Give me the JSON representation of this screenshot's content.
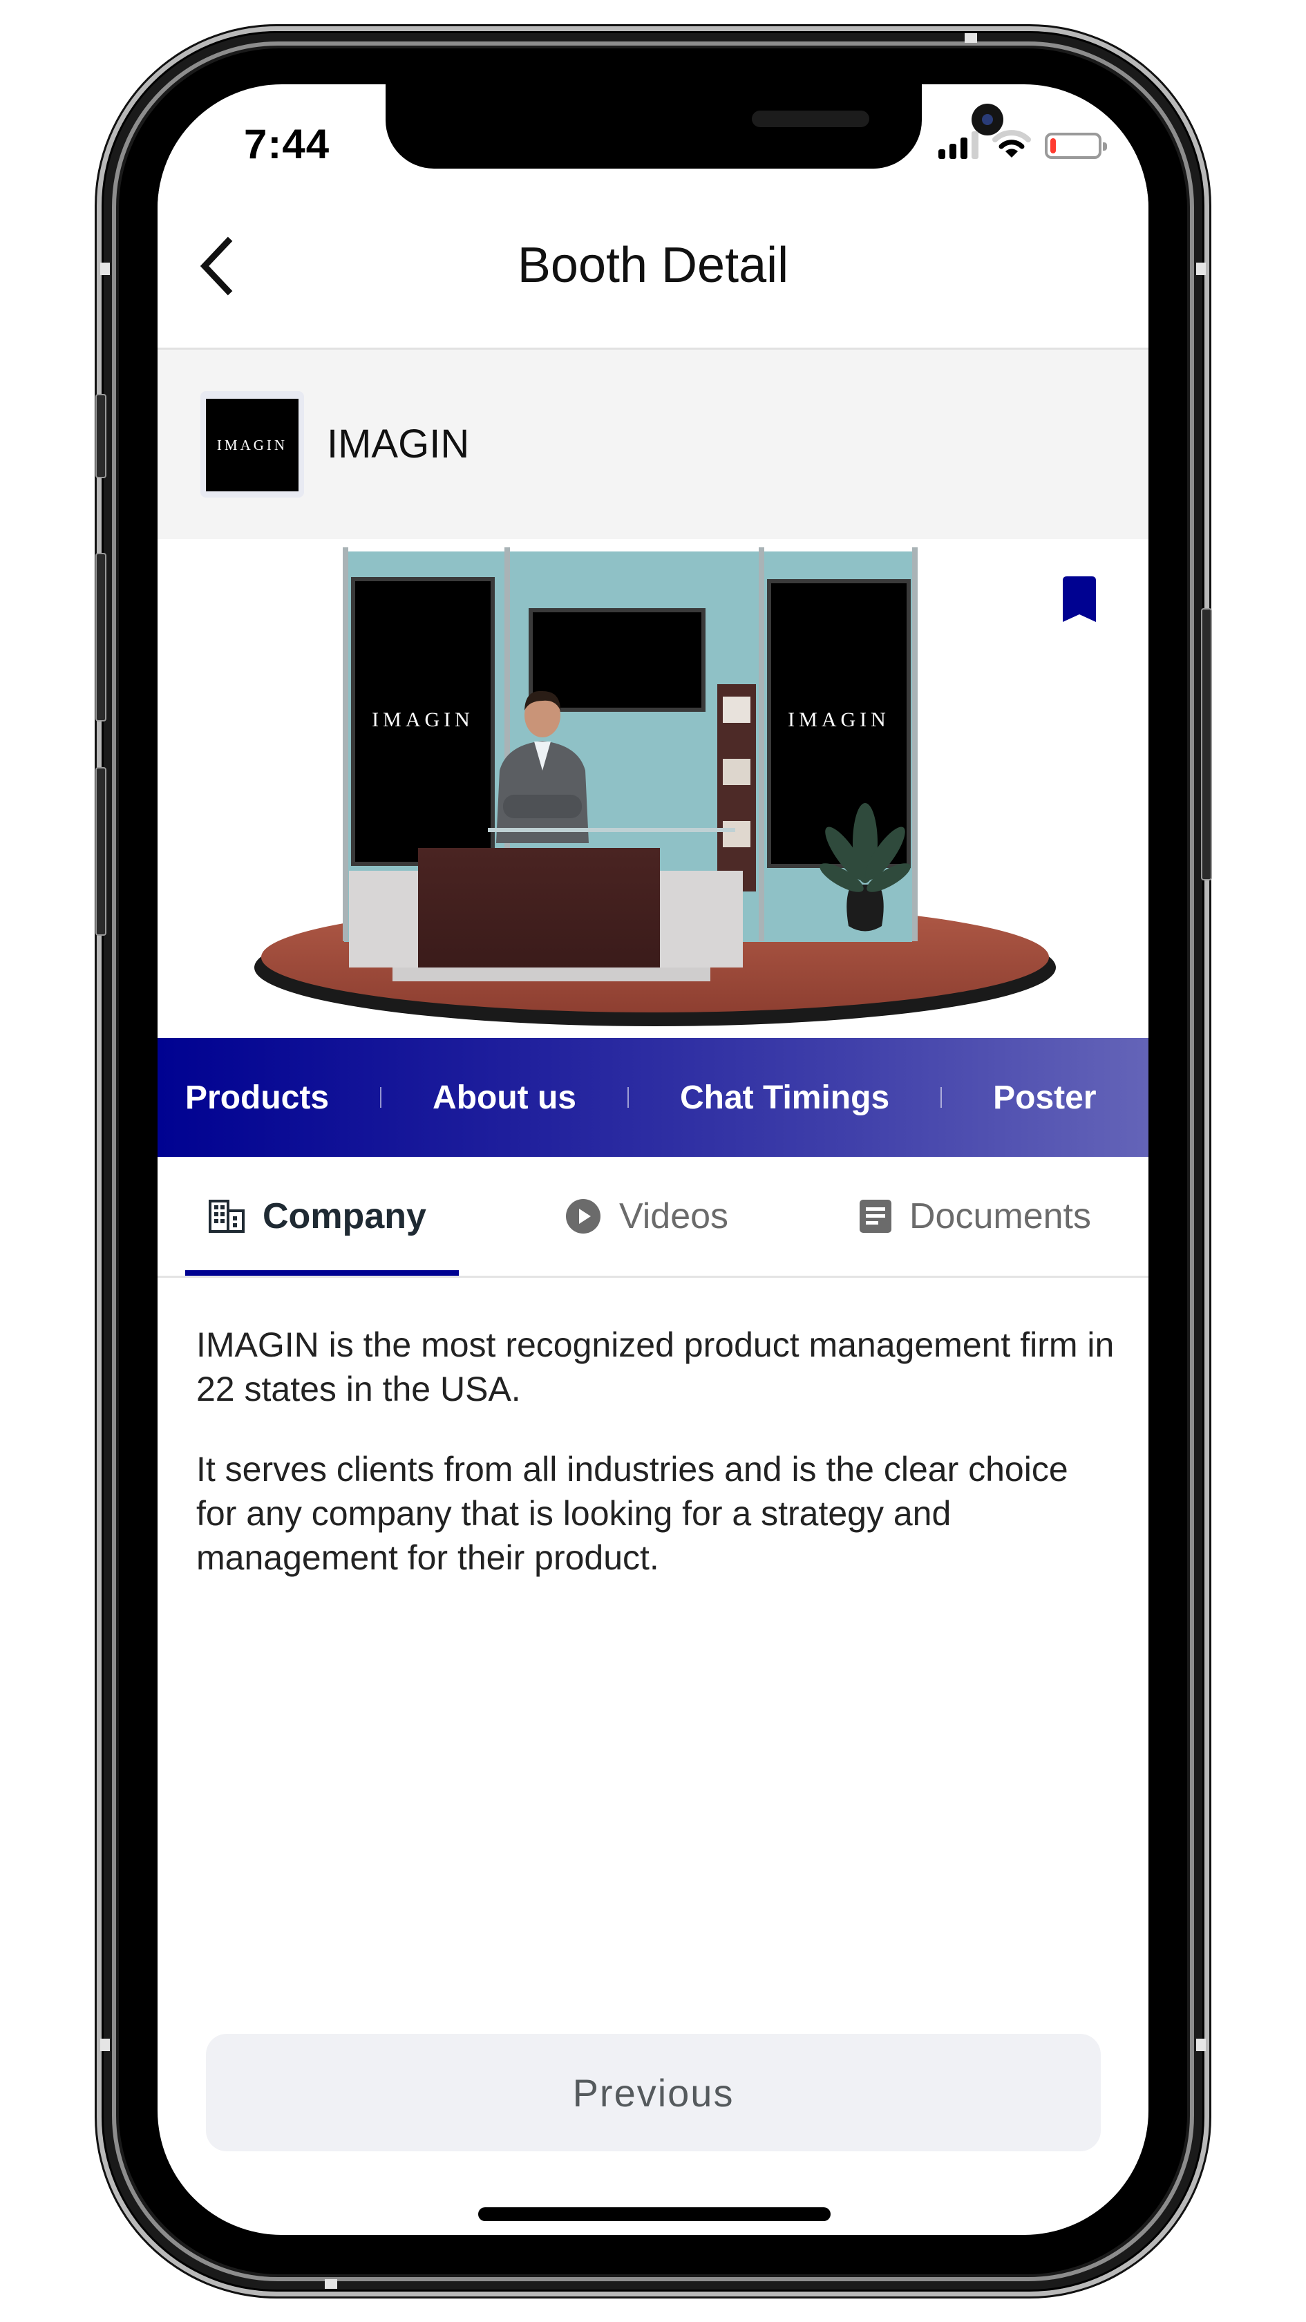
{
  "status_bar": {
    "time": "7:44",
    "signal_bars_active": 3,
    "signal_bars_total": 4,
    "battery_level_percent": 12,
    "battery_color": "#ff3b30"
  },
  "header": {
    "title": "Booth Detail",
    "back_icon": "chevron-left-icon"
  },
  "company": {
    "logo_text": "IMAGIN",
    "name": "IMAGIN"
  },
  "booth_image": {
    "banner_left_text": "IMAGIN",
    "banner_right_text": "IMAGIN",
    "bookmark_icon": "bookmark-icon",
    "bookmark_color": "#000291"
  },
  "section_nav": {
    "items": [
      {
        "label": "Products"
      },
      {
        "label": "About us"
      },
      {
        "label": "Chat Timings"
      },
      {
        "label": "Poster"
      }
    ],
    "gradient_start": "#000291",
    "gradient_end": "#6464b8"
  },
  "tabs": {
    "items": [
      {
        "label": "Company",
        "icon": "building-icon",
        "active": true
      },
      {
        "label": "Videos",
        "icon": "play-circle-icon",
        "active": false
      },
      {
        "label": "Documents",
        "icon": "document-icon",
        "active": false
      }
    ],
    "active_color": "#000291"
  },
  "content": {
    "paragraphs": [
      "IMAGIN is the most recognized product management firm in 22 states in the USA.",
      "It serves clients from all industries and is the clear choice for any company that is looking for a strategy and management for their product."
    ]
  },
  "footer": {
    "previous_label": "Previous"
  }
}
